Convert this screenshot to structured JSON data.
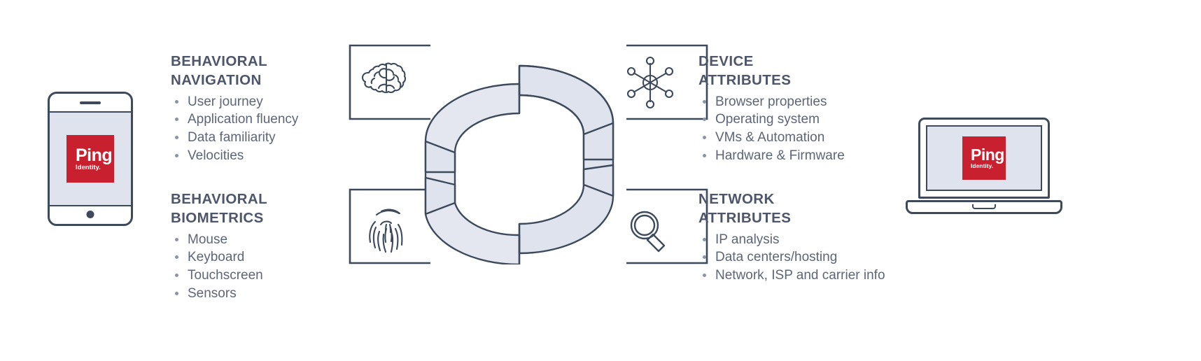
{
  "brand": {
    "name": "Ping",
    "tagline": "Identity.",
    "accent_color": "#c8202e",
    "ink_color": "#3c4a5c",
    "text_color": "#4d566b",
    "ring_fill": "#dfe3ed",
    "background": "#ffffff"
  },
  "devices": [
    {
      "name": "mobile-phone",
      "logo_word": "Ping",
      "logo_sub": "Identity."
    },
    {
      "name": "laptop",
      "logo_word": "Ping",
      "logo_sub": "Identity."
    }
  ],
  "blocks": [
    {
      "id": "behavioral-navigation",
      "title": "BEHAVIORAL\nNAVIGATION",
      "icon": "brain-icon",
      "side": "left",
      "bullets": [
        "User journey",
        "Application fluency",
        "Data familiarity",
        "Velocities"
      ]
    },
    {
      "id": "behavioral-biometrics",
      "title": "BEHAVIORAL\nBIOMETRICS",
      "icon": "fingerprint-icon",
      "side": "left",
      "bullets": [
        "Mouse",
        "Keyboard",
        "Touchscreen",
        "Sensors"
      ]
    },
    {
      "id": "device-attributes",
      "title": "DEVICE\nATTRIBUTES",
      "icon": "network-nodes-icon",
      "side": "right",
      "bullets": [
        "Browser properties",
        "Operating system",
        "VMs & Automation",
        "Hardware & Firmware"
      ]
    },
    {
      "id": "network-attributes",
      "title": "NETWORK\nATTRIBUTES",
      "icon": "magnifier-icon",
      "side": "right",
      "bullets": [
        "IP analysis",
        "Data centers/hosting",
        "Network, ISP and carrier info"
      ]
    }
  ],
  "center": {
    "name": "segmented-ring-graphic",
    "description": "3D segmented ring"
  }
}
